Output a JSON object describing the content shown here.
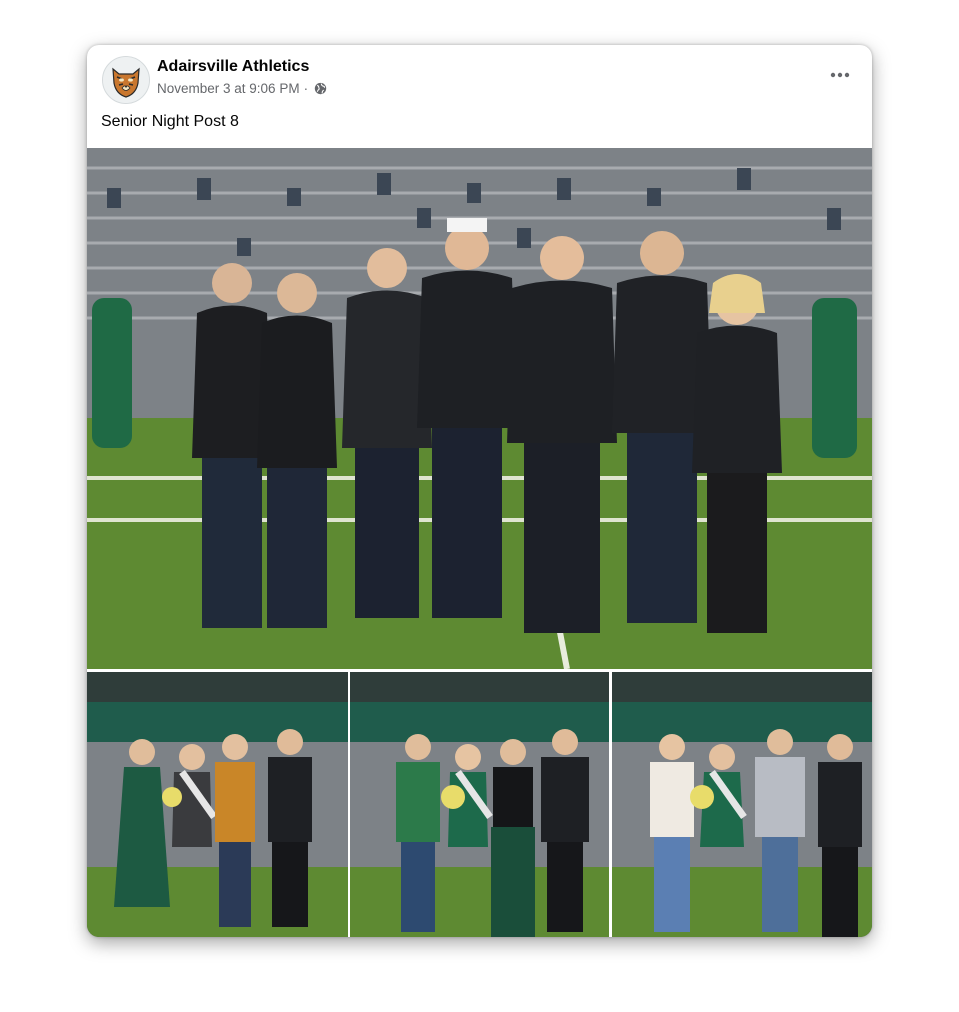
{
  "post": {
    "author": "Adairsville Athletics",
    "timestamp": "November 3 at 9:06 PM",
    "separator": "·",
    "privacy_icon": "globe-icon",
    "more_icon": "more-options-icon",
    "caption": "Senior Night Post 8"
  },
  "photos": [
    {
      "name": "main-group-photo",
      "depicts": "staff-group-on-field"
    },
    {
      "name": "honoree-photo-1",
      "depicts": "senior-with-family"
    },
    {
      "name": "honoree-photo-2",
      "depicts": "senior-with-family"
    },
    {
      "name": "honoree-photo-3",
      "depicts": "senior-with-family"
    }
  ],
  "colors": {
    "author_text": "#050505",
    "meta_text": "#65676b",
    "field_green": "#5e8a32",
    "stand_gray": "#8f9296",
    "team_green": "#14604a"
  }
}
